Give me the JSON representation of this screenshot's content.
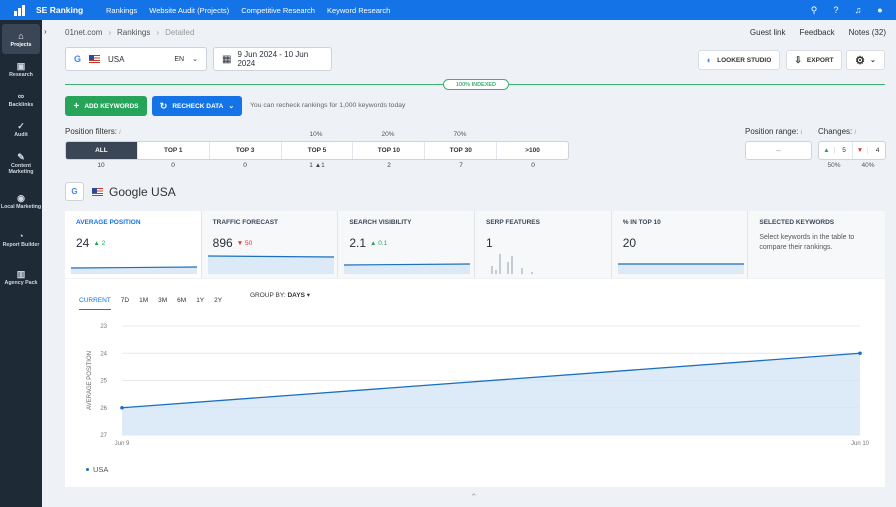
{
  "app": {
    "brand": "SE Ranking",
    "nav": [
      "Rankings",
      "Website Audit (Projects)",
      "Competitive Research",
      "Keyword Research"
    ]
  },
  "sidebar": {
    "items": [
      {
        "label": "Projects",
        "icon": "home-icon",
        "active": true
      },
      {
        "label": "Research",
        "icon": "research-icon"
      },
      {
        "label": "Backlinks",
        "icon": "link-icon"
      },
      {
        "label": "Audit",
        "icon": "check-circle-icon"
      },
      {
        "label": "Content Marketing",
        "icon": "edit-icon"
      },
      {
        "label": "Local Marketing",
        "icon": "pin-icon"
      },
      {
        "label": "Report Builder",
        "icon": "chart-pie-icon"
      },
      {
        "label": "Agency Pack",
        "icon": "building-icon"
      }
    ]
  },
  "breadcrumb": [
    "01net.com",
    "Rankings",
    "Detailed"
  ],
  "toplinks": [
    "Guest link",
    "Feedback",
    "Notes (32)"
  ],
  "location": {
    "country": "USA",
    "lang": "EN"
  },
  "date_range": "9 Jun 2024 - 10 Jun 2024",
  "buttons": {
    "looker": "LOOKER STUDIO",
    "export": "EXPORT",
    "add_keywords": "ADD KEYWORDS",
    "recheck": "RECHECK DATA"
  },
  "indexed": "100% INDEXED",
  "recheck_note": "You can recheck rankings for 1,000 keywords today",
  "filters": {
    "label": "Position filters:",
    "tabs": [
      "ALL",
      "TOP 1",
      "TOP 3",
      "TOP 5",
      "TOP 10",
      "TOP 30",
      ">100"
    ],
    "percents": {
      "top5": "10%",
      "top10": "20%",
      "top30": "70%"
    },
    "counts": [
      "10",
      "0",
      "0",
      "1",
      "2",
      "7",
      "0"
    ],
    "top5_change": "1"
  },
  "position_range": {
    "label": "Position range:",
    "placeholder": "–"
  },
  "changes": {
    "label": "Changes:",
    "up": "5",
    "down": "4",
    "up_pct": "50%",
    "down_pct": "40%"
  },
  "engine": "Google USA",
  "cards": [
    {
      "title": "AVERAGE POSITION",
      "value": "24",
      "delta": "2",
      "dir": "up"
    },
    {
      "title": "TRAFFIC FORECAST",
      "value": "896",
      "delta": "50",
      "dir": "down"
    },
    {
      "title": "SEARCH VISIBILITY",
      "value": "2.1",
      "delta": "0.1",
      "dir": "up"
    },
    {
      "title": "SERP FEATURES",
      "value": "1"
    },
    {
      "title": "% IN TOP 10",
      "value": "20"
    },
    {
      "title": "SELECTED KEYWORDS",
      "desc": "Select keywords in the table to compare their rankings."
    }
  ],
  "time_ranges": [
    "CURRENT",
    "7D",
    "1M",
    "3M",
    "6M",
    "1Y",
    "2Y"
  ],
  "groupby": {
    "label": "GROUP BY:",
    "value": "DAYS"
  },
  "chart_data": {
    "type": "area",
    "x": [
      "Jun 9",
      "Jun 10"
    ],
    "series": [
      {
        "name": "USA",
        "values": [
          26,
          24
        ]
      }
    ],
    "ylabel": "AVERAGE POSITION",
    "yticks": [
      23,
      24,
      25,
      26,
      27
    ],
    "ylim": [
      23,
      27
    ],
    "y_inverted": true,
    "grid": true,
    "color": "#1c6fbf"
  }
}
